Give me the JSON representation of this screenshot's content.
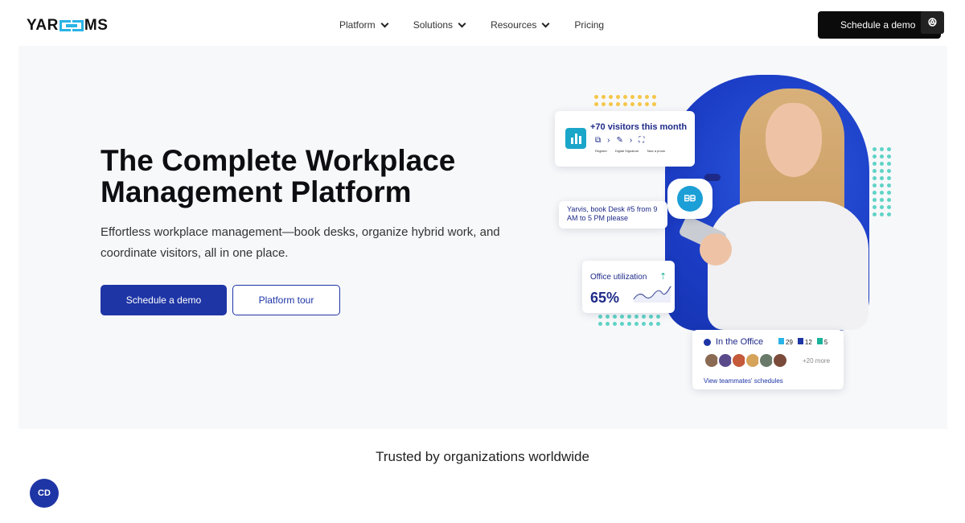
{
  "nav": {
    "logo_left": "YAR",
    "logo_right": "MS",
    "menu": [
      {
        "label": "Platform"
      },
      {
        "label": "Solutions"
      },
      {
        "label": "Resources"
      },
      {
        "label": "Pricing"
      }
    ],
    "cta": "Schedule a demo"
  },
  "hero": {
    "title": "The Complete Workplace Management Platform",
    "subtitle": "Effortless workplace management—book desks, organize hybrid work, and coordinate visitors, all in one place.",
    "primary_button": "Schedule a demo",
    "secondary_button": "Platform tour"
  },
  "cards": {
    "visitors": {
      "title": "+70 visitors this month",
      "steps": [
        "Register",
        "Digital Signature",
        "Take a photo"
      ]
    },
    "chat": "Yarvis, book Desk #5 from 9 AM to 5 PM please",
    "assistant_badge": "ᗷᗷ",
    "utilization": {
      "title": "Office utilization",
      "value": "65%"
    },
    "office": {
      "title": "In the Office",
      "counts": [
        "29",
        "12",
        "5"
      ],
      "more": "+20 more",
      "link": "View teammates' schedules"
    }
  },
  "trusted": "Trusted by organizations worldwide",
  "colors": {
    "accent": "#1e35a6",
    "cyan": "#2ab3e6",
    "teal": "#19b39a",
    "yellow": "#f5c64a",
    "hero_bg": "#f7f8fa"
  }
}
